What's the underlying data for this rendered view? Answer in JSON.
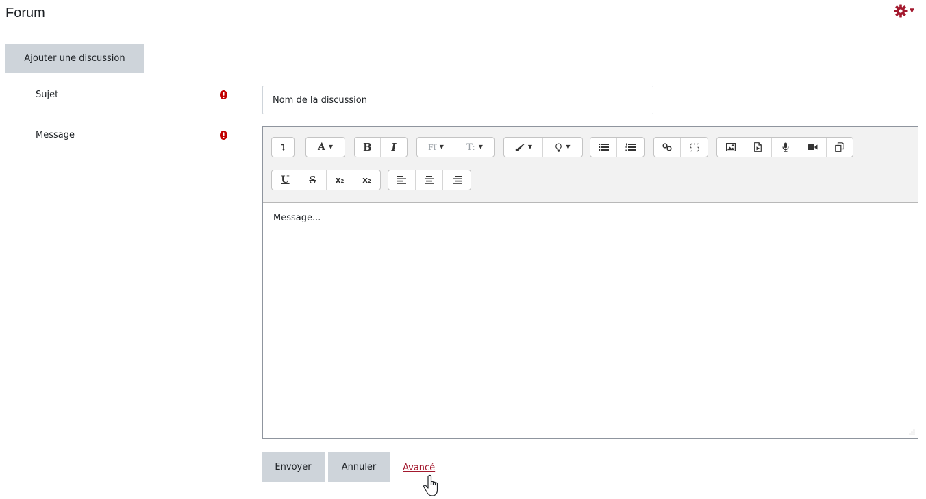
{
  "header": {
    "title": "Forum",
    "settings_icon": "gear-icon"
  },
  "actions": {
    "add_discussion_label": "Ajouter une discussion"
  },
  "form": {
    "subject": {
      "label": "Sujet",
      "placeholder": "Nom de la discussion",
      "value": ""
    },
    "message": {
      "label": "Message",
      "placeholder": "Message..."
    },
    "submit_label": "Envoyer",
    "cancel_label": "Annuler",
    "advanced_label": "Avancé"
  },
  "editor": {
    "toolbar_row1": [
      "collapse-toolbar-icon",
      "font-style-icon",
      "bold-icon",
      "italic-icon",
      "font-family-icon",
      "font-size-icon",
      "text-color-icon",
      "highlight-icon",
      "unordered-list-icon",
      "ordered-list-icon",
      "link-icon",
      "unlink-icon",
      "image-icon",
      "media-icon",
      "audio-record-icon",
      "video-record-icon",
      "copy-format-icon"
    ],
    "toolbar_row2": [
      "underline-icon",
      "strikethrough-icon",
      "subscript-icon",
      "superscript-icon",
      "align-left-icon",
      "align-center-icon",
      "align-right-icon"
    ]
  },
  "glyphs": {
    "font_style": "A",
    "bold": "B",
    "italic": "I",
    "font_family": "Ff",
    "font_size": "T:",
    "underline": "U",
    "strike": "S",
    "subscript_base": "x",
    "subscript_mark": "2",
    "superscript_base": "x",
    "superscript_mark": "2"
  },
  "colors": {
    "accent": "#a3192e",
    "required": "#c20000",
    "button_bg": "#ced4da",
    "toolbar_bg": "#f2f2f2"
  }
}
